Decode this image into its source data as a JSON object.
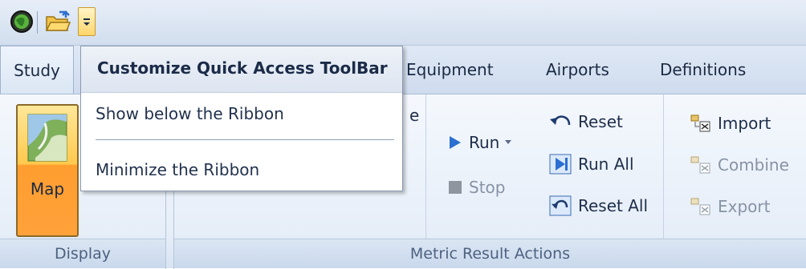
{
  "quick_access_toolbar": {
    "app_icon": "app-globe-icon",
    "open_icon": "open-folder-icon",
    "customize_icon": "customize-dropdown-icon"
  },
  "tabs": [
    {
      "label": "Study"
    },
    {
      "label": "Equipment"
    },
    {
      "label": "Airports"
    },
    {
      "label": "Definitions"
    }
  ],
  "groups": {
    "display": {
      "label": "Display",
      "map_label": "Map"
    },
    "metric_result_actions": {
      "label": "Metric Result Actions",
      "partial_text": "e",
      "run_label": "Run",
      "stop_label": "Stop",
      "reset_label": "Reset",
      "run_all_label": "Run All",
      "reset_all_label": "Reset All",
      "import_label": "Import",
      "combine_label": "Combine",
      "export_label": "Export"
    }
  },
  "menu": {
    "title": "Customize Quick Access ToolBar",
    "items": [
      {
        "label": "Show below the Ribbon"
      },
      {
        "label": "Minimize the Ribbon"
      }
    ]
  },
  "colors": {
    "accent_orange": "#ffb13d",
    "run_blue": "#2a6fd1",
    "ribbon_bg": "#e6eef8"
  }
}
